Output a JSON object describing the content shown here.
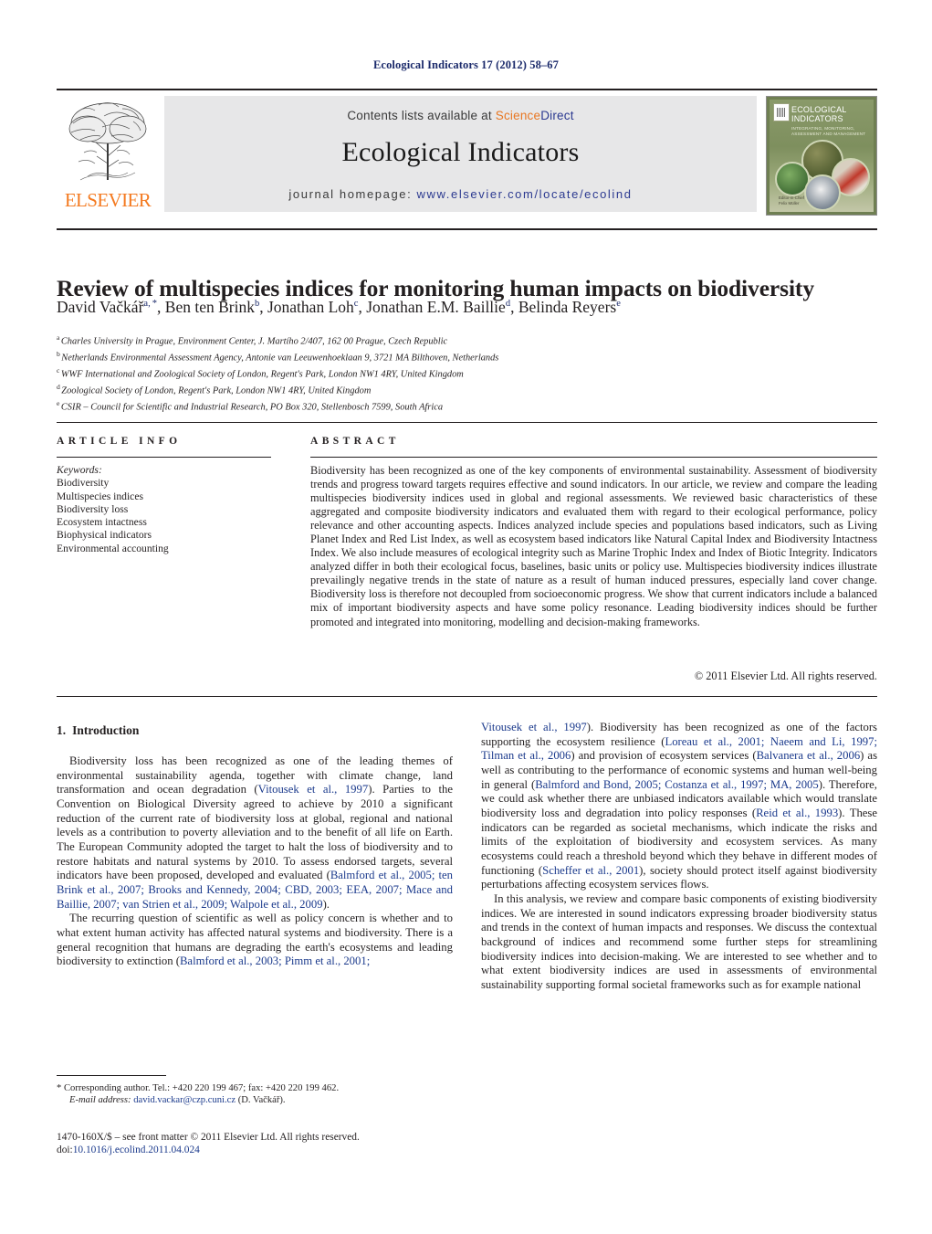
{
  "running_head": "Ecological Indicators 17 (2012) 58–67",
  "masthead": {
    "publisher_name": "ELSEVIER",
    "contents_prefix": "Contents lists available at ",
    "sciencedirect_first": "Science",
    "sciencedirect_second": "Direct",
    "journal_title": "Ecological Indicators",
    "homepage_label": "journal homepage:",
    "homepage_url": "www.elsevier.com/locate/ecolind",
    "cover": {
      "title_line1": "ECOLOGICAL",
      "title_line2": "INDICATORS",
      "subtitle": "INTEGRATING, MONITORING, ASSESSMENT AND MANAGEMENT",
      "footer_line1": "Editor-in-Chief",
      "footer_line2": "Felix Müller"
    }
  },
  "article": {
    "title": "Review of multispecies indices for monitoring human impacts on biodiversity",
    "authors": [
      {
        "name": "David Vačkář",
        "sup": "a, *"
      },
      {
        "name": "Ben ten Brink",
        "sup": "b"
      },
      {
        "name": "Jonathan Loh",
        "sup": "c"
      },
      {
        "name": "Jonathan E.M. Baillie",
        "sup": "d"
      },
      {
        "name": "Belinda Reyers",
        "sup": "e"
      }
    ],
    "affiliations": [
      {
        "mark": "a",
        "text": "Charles University in Prague, Environment Center, J. Martího 2/407, 162 00 Prague, Czech Republic"
      },
      {
        "mark": "b",
        "text": "Netherlands Environmental Assessment Agency, Antonie van Leeuwenhoeklaan 9, 3721 MA Bilthoven, Netherlands"
      },
      {
        "mark": "c",
        "text": "WWF International and Zoological Society of London, Regent's Park, London NW1 4RY, United Kingdom"
      },
      {
        "mark": "d",
        "text": "Zoological Society of London, Regent's Park, London NW1 4RY, United Kingdom"
      },
      {
        "mark": "e",
        "text": "CSIR – Council for Scientific and Industrial Research, PO Box 320, Stellenbosch 7599, South Africa"
      }
    ]
  },
  "article_info": {
    "heading": "ARTICLE INFO",
    "keywords_label": "Keywords:",
    "keywords": [
      "Biodiversity",
      "Multispecies indices",
      "Biodiversity loss",
      "Ecosystem intactness",
      "Biophysical indicators",
      "Environmental accounting"
    ]
  },
  "abstract": {
    "heading": "ABSTRACT",
    "text": "Biodiversity has been recognized as one of the key components of environmental sustainability. Assessment of biodiversity trends and progress toward targets requires effective and sound indicators. In our article, we review and compare the leading multispecies biodiversity indices used in global and regional assessments. We reviewed basic characteristics of these aggregated and composite biodiversity indicators and evaluated them with regard to their ecological performance, policy relevance and other accounting aspects. Indices analyzed include species and populations based indicators, such as Living Planet Index and Red List Index, as well as ecosystem based indicators like Natural Capital Index and Biodiversity Intactness Index. We also include measures of ecological integrity such as Marine Trophic Index and Index of Biotic Integrity. Indicators analyzed differ in both their ecological focus, baselines, basic units or policy use. Multispecies biodiversity indices illustrate prevailingly negative trends in the state of nature as a result of human induced pressures, especially land cover change. Biodiversity loss is therefore not decoupled from socioeconomic progress. We show that current indicators include a balanced mix of important biodiversity aspects and have some policy resonance. Leading biodiversity indices should be further promoted and integrated into monitoring, modelling and decision-making frameworks.",
    "copyright": "© 2011 Elsevier Ltd. All rights reserved."
  },
  "body": {
    "section_number": "1.",
    "section_title": "Introduction",
    "left_column": {
      "para1_a": "Biodiversity loss has been recognized as one of the leading themes of environmental sustainability agenda, together with climate change, land transformation and ocean degradation (",
      "para1_cite1": "Vitousek et al., 1997",
      "para1_b": "). Parties to the Convention on Biological Diversity agreed to achieve by 2010 a significant reduction of the current rate of biodiversity loss at global, regional and national levels as a contribution to poverty alleviation and to the benefit of all life on Earth. The European Community adopted the target to halt the loss of biodiversity and to restore habitats and natural systems by 2010. To assess endorsed targets, several indicators have been proposed, developed and evaluated (",
      "para1_cite2": "Balmford et al., 2005; ten Brink et al., 2007; Brooks and Kennedy, 2004; CBD, 2003; EEA, 2007; Mace and Baillie, 2007; van Strien et al., 2009; Walpole et al., 2009",
      "para1_c": ").",
      "para2_a": "The recurring question of scientific as well as policy concern is whether and to what extent human activity has affected natural systems and biodiversity. There is a general recognition that humans are degrading the earth's ecosystems and leading biodiversity to extinction (",
      "para2_cite1": "Balmford et al., 2003; Pimm et al., 2001;",
      "para2_b": ""
    },
    "right_column": {
      "cont_cite1": "Vitousek et al., 1997",
      "cont_a": "). Biodiversity has been recognized as one of the factors supporting the ecosystem resilience (",
      "cont_cite2": "Loreau et al., 2001; Naeem and Li, 1997; Tilman et al., 2006",
      "cont_b": ") and provision of ecosystem services (",
      "cont_cite3": "Balvanera et al., 2006",
      "cont_c": ") as well as contributing to the performance of economic systems and human well-being in general (",
      "cont_cite4": "Balmford and Bond, 2005; Costanza et al., 1997; MA, 2005",
      "cont_d": "). Therefore, we could ask whether there are unbiased indicators available which would translate biodiversity loss and degradation into policy responses (",
      "cont_cite5": "Reid et al., 1993",
      "cont_e": "). These indicators can be regarded as societal mechanisms, which indicate the risks and limits of the exploitation of biodiversity and ecosystem services. As many ecosystems could reach a threshold beyond which they behave in different modes of functioning (",
      "cont_cite6": "Scheffer et al., 2001",
      "cont_f": "), society should protect itself against biodiversity perturbations affecting ecosystem services flows.",
      "para2": "In this analysis, we review and compare basic components of existing biodiversity indices. We are interested in sound indicators expressing broader biodiversity status and trends in the context of human impacts and responses. We discuss the contextual background of indices and recommend some further steps for streamlining biodiversity indices into decision-making. We are interested to see whether and to what extent biodiversity indices are used in assessments of environmental sustainability supporting formal societal frameworks such as for example national"
    }
  },
  "footnotes": {
    "corresponding_marker": "*",
    "corresponding_text": "Corresponding author. Tel.: +420 220 199 467; fax: +420 220 199 462.",
    "email_label": "E-mail address:",
    "email": "david.vackar@czp.cuni.cz",
    "email_owner": "(D. Vačkář).",
    "issn_line": "1470-160X/$ – see front matter © 2011 Elsevier Ltd. All rights reserved.",
    "doi_label": "doi:",
    "doi_value": "10.1016/j.ecolind.2011.04.024"
  }
}
